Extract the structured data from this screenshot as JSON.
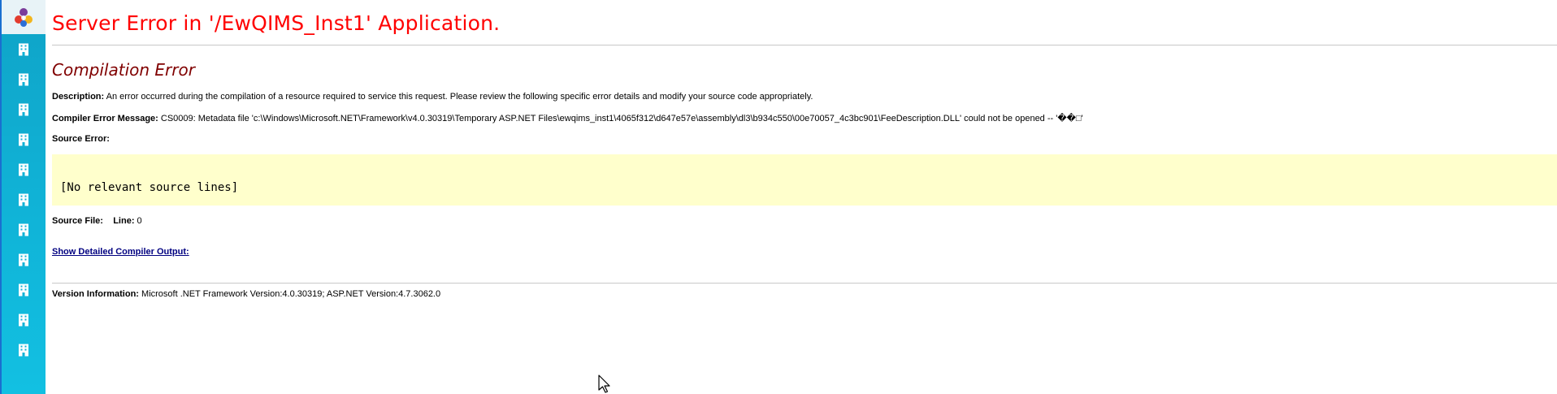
{
  "sidebar": {
    "items": [
      {
        "icon": "building-icon"
      },
      {
        "icon": "building-icon"
      },
      {
        "icon": "building-icon"
      },
      {
        "icon": "building-icon"
      },
      {
        "icon": "building-icon"
      },
      {
        "icon": "building-icon"
      },
      {
        "icon": "building-icon"
      },
      {
        "icon": "building-icon"
      },
      {
        "icon": "building-icon"
      },
      {
        "icon": "building-icon"
      },
      {
        "icon": "building-icon"
      }
    ]
  },
  "page": {
    "title": "Server Error in '/EwQIMS_Inst1' Application.",
    "subtitle": "Compilation Error",
    "description_label": "Description:",
    "description_text": " An error occurred during the compilation of a resource required to service this request. Please review the following specific error details and modify your source code appropriately.",
    "compiler_error_label": "Compiler Error Message:",
    "compiler_error_text": " CS0009: Metadata file 'c:\\Windows\\Microsoft.NET\\Framework\\v4.0.30319\\Temporary ASP.NET Files\\ewqims_inst1\\4065f312\\d647e57e\\assembly\\dl3\\b934c550\\00e70057_4c3bc901\\FeeDescription.DLL' could not be opened -- '��□'",
    "source_error_label": "Source Error:",
    "source_code": "[No relevant source lines]",
    "source_file_label": "Source File:",
    "line_label": "Line:",
    "line_value": " 0",
    "show_output_link": "Show Detailed Compiler Output:",
    "version_label": "Version Information:",
    "version_text": " Microsoft .NET Framework Version:4.0.30319; ASP.NET Version:4.7.3062.0"
  },
  "colors": {
    "title": "#ff0000",
    "subtitle": "#800000",
    "code_bg": "#ffffcc",
    "link": "#000080",
    "sidebar": "#10b2d6"
  }
}
